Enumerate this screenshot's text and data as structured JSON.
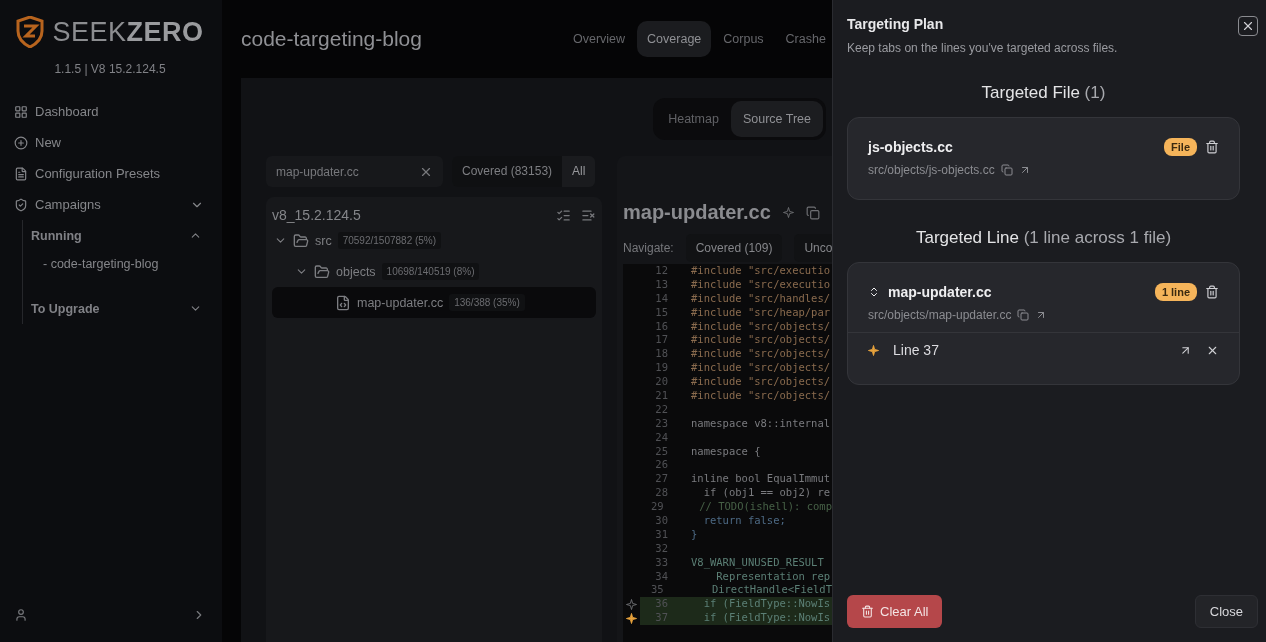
{
  "brand": {
    "name_light": "SEEK",
    "name_bold": "ZERO",
    "version": "1.1.5 | V8 15.2.124.5"
  },
  "nav": [
    {
      "label": "Dashboard",
      "kind": "grid"
    },
    {
      "label": "New",
      "kind": "plus"
    },
    {
      "label": "Configuration Presets",
      "kind": "file"
    },
    {
      "label": "Campaigns",
      "kind": "shield",
      "groups": [
        {
          "label": "Running",
          "expanded": true,
          "children": [
            {
              "label": "- code-targeting-blog"
            }
          ]
        },
        {
          "label": "To Upgrade",
          "expanded": false
        }
      ]
    }
  ],
  "campaign": {
    "title": "code-targeting-blog",
    "tabs": [
      {
        "label": "Overview",
        "selected": false
      },
      {
        "label": "Coverage",
        "selected": true
      },
      {
        "label": "Corpus",
        "selected": false
      },
      {
        "label": "Crashe",
        "selected": false
      }
    ]
  },
  "view_toggle": [
    {
      "label": "Heatmap",
      "selected": false
    },
    {
      "label": "Source Tree",
      "selected": true
    }
  ],
  "search": {
    "value": "map-updater.cc"
  },
  "filter": [
    {
      "label": "Covered (83153)",
      "selected": false
    },
    {
      "label": "All",
      "selected": true
    }
  ],
  "tree": {
    "root": "v8_15.2.124.5",
    "items": [
      {
        "name": "src",
        "kind": "folder",
        "count": "70592/1507882 (5%)",
        "selected": false,
        "expanded": true,
        "children": [
          {
            "name": "objects",
            "kind": "folder",
            "count": "10698/140519 (8%)",
            "selected": false,
            "expanded": true,
            "children": [
              {
                "name": "map-updater.cc",
                "kind": "file",
                "count": "136/388 (35%)",
                "selected": true
              }
            ]
          }
        ]
      }
    ]
  },
  "source": {
    "file": "map-updater.cc",
    "navigate_label": "Navigate:",
    "navigate": [
      "Covered (109)",
      "Unco"
    ],
    "lines": [
      {
        "n": "12",
        "code": "#include \"src/executio",
        "kind": "directive",
        "covered": false
      },
      {
        "n": "13",
        "code": "#include \"src/executio",
        "kind": "directive",
        "covered": false
      },
      {
        "n": "14",
        "code": "#include \"src/handles/",
        "kind": "directive",
        "covered": false
      },
      {
        "n": "15",
        "code": "#include \"src/heap/par",
        "kind": "directive",
        "covered": false
      },
      {
        "n": "16",
        "code": "#include \"src/objects/",
        "kind": "directive",
        "covered": false
      },
      {
        "n": "17",
        "code": "#include \"src/objects/",
        "kind": "directive",
        "covered": false
      },
      {
        "n": "18",
        "code": "#include \"src/objects/",
        "kind": "directive",
        "covered": false
      },
      {
        "n": "19",
        "code": "#include \"src/objects/",
        "kind": "directive",
        "covered": false
      },
      {
        "n": "20",
        "code": "#include \"src/objects/",
        "kind": "directive",
        "covered": false
      },
      {
        "n": "21",
        "code": "#include \"src/objects/",
        "kind": "directive",
        "covered": false
      },
      {
        "n": "22",
        "covered": false
      },
      {
        "n": "23",
        "code": "namespace v8::internal",
        "kind": "code",
        "covered": false
      },
      {
        "n": "24",
        "covered": false
      },
      {
        "n": "25",
        "code": "namespace {",
        "kind": "code",
        "covered": false
      },
      {
        "n": "26",
        "covered": false
      },
      {
        "n": "27",
        "code": "inline bool EqualImmut",
        "kind": "code",
        "covered": false
      },
      {
        "n": "28",
        "code": "  if (obj1 == obj2) re",
        "kind": "code",
        "covered": false
      },
      {
        "n": "29",
        "code": "  // TODO(ishell): comp",
        "kind": "comment",
        "covered": false
      },
      {
        "n": "30",
        "code": "  return false;",
        "kind": "keyword",
        "covered": false
      },
      {
        "n": "31",
        "code": "}",
        "kind": "keyword",
        "covered": false
      },
      {
        "n": "32",
        "covered": false
      },
      {
        "n": "33",
        "code": "V8_WARN_UNUSED_RESULT",
        "kind": "type",
        "covered": false
      },
      {
        "n": "34",
        "code": "    Representation rep",
        "kind": "type",
        "covered": false
      },
      {
        "n": "35",
        "code": "    DirectHandle<FieldT",
        "kind": "type",
        "covered": false
      },
      {
        "n": "36",
        "code": "  if (FieldType::NowIs",
        "kind": "type",
        "covered": true,
        "marker": true,
        "targeted": false
      },
      {
        "n": "37",
        "code": "  if (FieldType::NowIs",
        "kind": "type",
        "covered": true,
        "marker": true,
        "targeted": true
      }
    ]
  },
  "plan": {
    "title": "Targeting Plan",
    "subtitle": "Keep tabs on the lines you've targeted across files.",
    "file_heading": "Targeted File",
    "file_count": "(1)",
    "files": [
      {
        "name": "js-objects.cc",
        "path": "src/objects/js-objects.cc",
        "badge": "File"
      }
    ],
    "line_heading": "Targeted Line",
    "line_count": "(1 line across 1 file)",
    "line_groups": [
      {
        "name": "map-updater.cc",
        "path": "src/objects/map-updater.cc",
        "badge": "1 line",
        "lines": [
          {
            "label": "Line 37"
          }
        ]
      }
    ],
    "clear_label": "Clear All",
    "close_label": "Close"
  }
}
